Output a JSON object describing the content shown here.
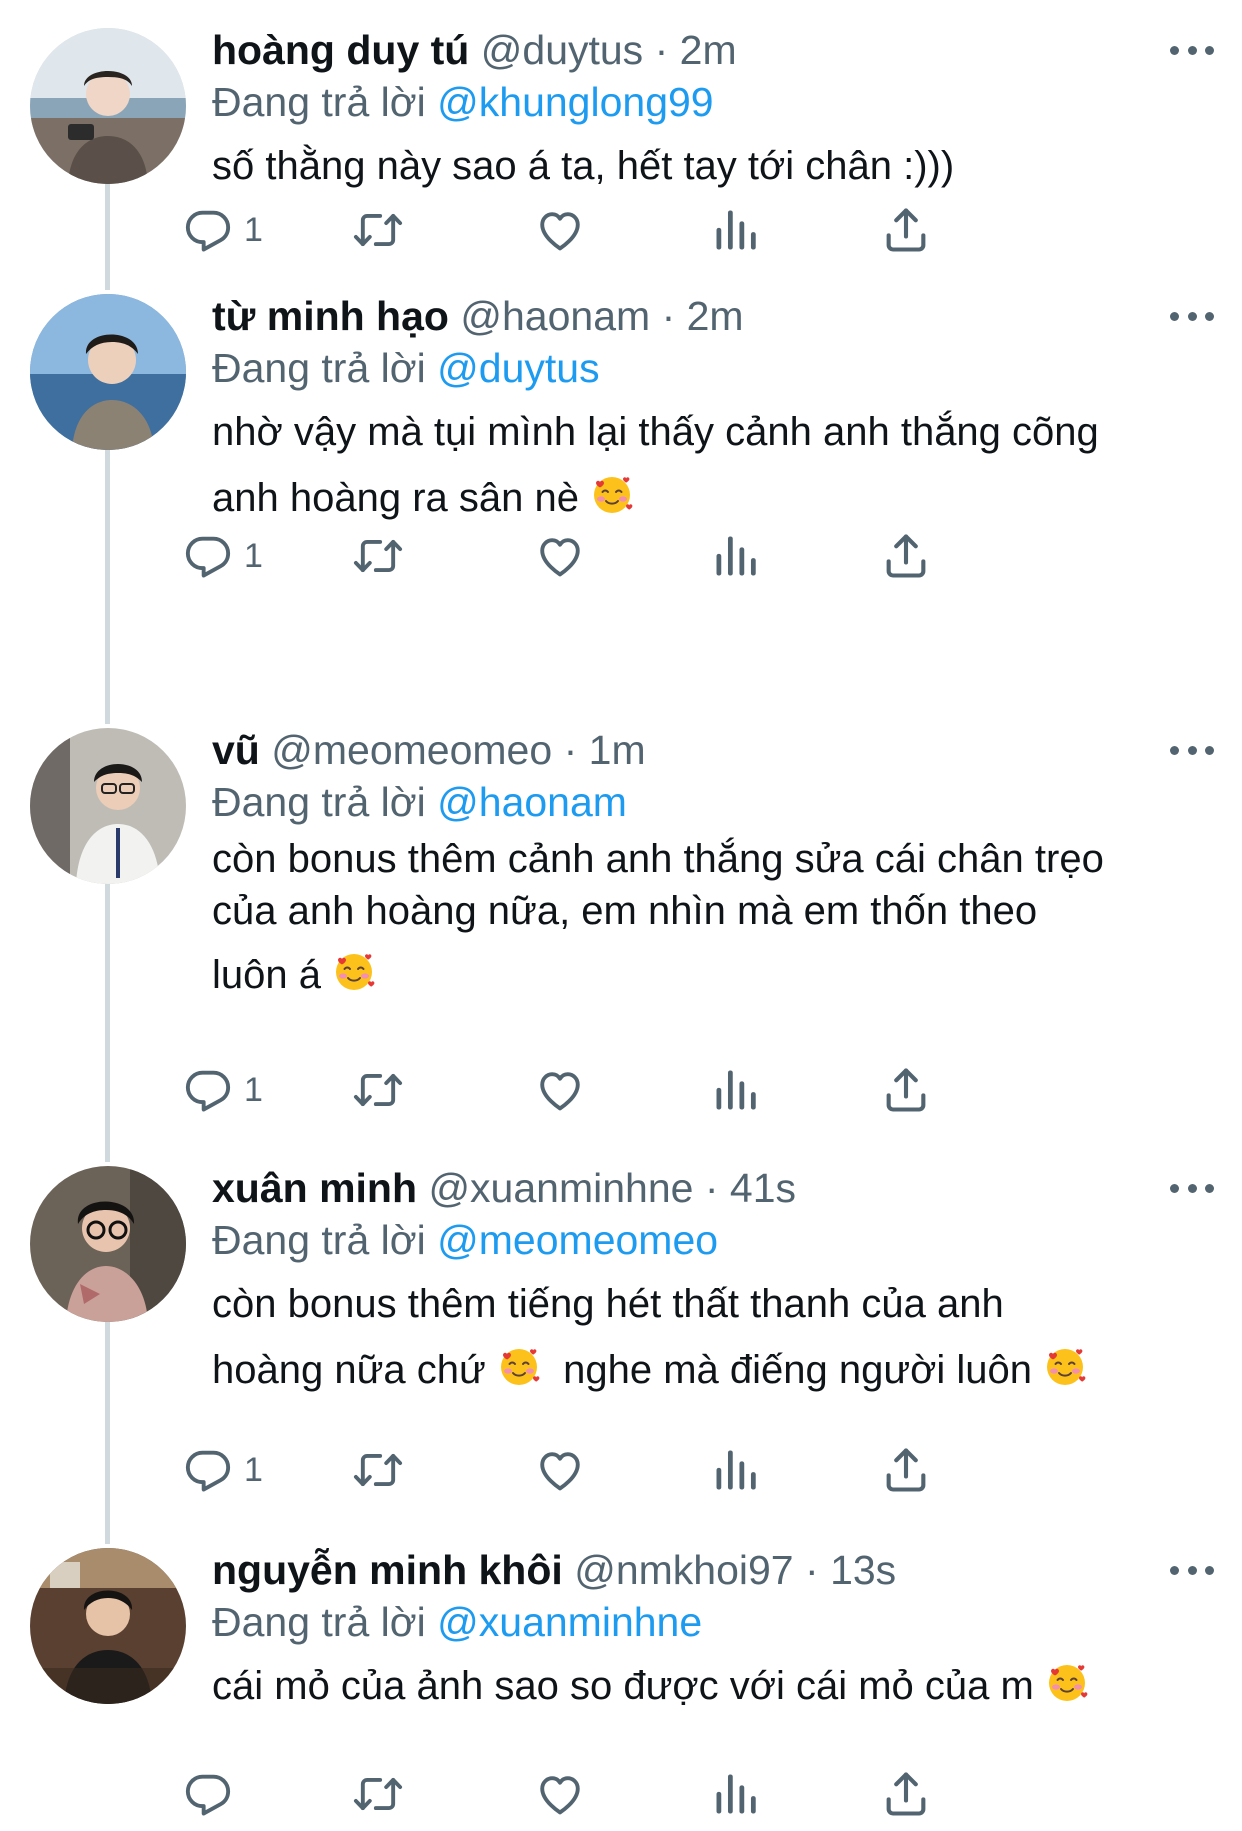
{
  "reply_prefix": "Đang trả lời",
  "tweets": [
    {
      "name": "hoàng duy tú",
      "handle": "@duytus",
      "time": "2m",
      "reply_to": "@khunglong99",
      "lines": [
        "số thằng này sao á ta, hết tay tới chân :)))"
      ],
      "reply_count": "1",
      "avatar_bg": "#cfd6dc"
    },
    {
      "name": "từ minh hạo",
      "handle": "@haonam",
      "time": "2m",
      "reply_to": "@duytus",
      "lines": [
        "nhờ vậy mà tụi mình lại thấy cảnh anh thắng cõng",
        "anh hoàng ra sân nè"
      ],
      "reply_count": "1",
      "avatar_bg": "#5d8fc4"
    },
    {
      "name": "vũ",
      "handle": "@meomeomeo",
      "time": "1m",
      "reply_to": "@haonam",
      "lines": [
        "còn bonus thêm cảnh anh thắng sửa cái chân trẹo",
        "của anh hoàng nữa, em nhìn mà em thốn theo",
        "luôn á"
      ],
      "reply_count": "1",
      "avatar_bg": "#bfbcb6"
    },
    {
      "name": "xuân minh",
      "handle": "@xuanminhne",
      "time": "41s",
      "reply_to": "@meomeomeo",
      "lines": [
        "còn bonus thêm tiếng hét thất thanh của anh",
        "hoàng nữa chứ",
        "nghe mà điếng người luôn"
      ],
      "reply_count": "1",
      "avatar_bg": "#6b6258"
    },
    {
      "name": "nguyễn minh khôi",
      "handle": "@nmkhoi97",
      "time": "13s",
      "reply_to": "@xuanminhne",
      "lines": [
        "cái mỏ của ảnh sao so được với cái mỏ của m"
      ],
      "reply_count": "",
      "avatar_bg": "#5a4030"
    }
  ],
  "colors": {
    "accent": "#1d9bf0",
    "secondary": "#536471",
    "primary": "#0f1419",
    "thread_line": "#cfd9de"
  },
  "icons": [
    "reply-icon",
    "retweet-icon",
    "like-icon",
    "views-icon",
    "share-icon",
    "more-icon",
    "smiling-face-with-hearts-emoji"
  ]
}
